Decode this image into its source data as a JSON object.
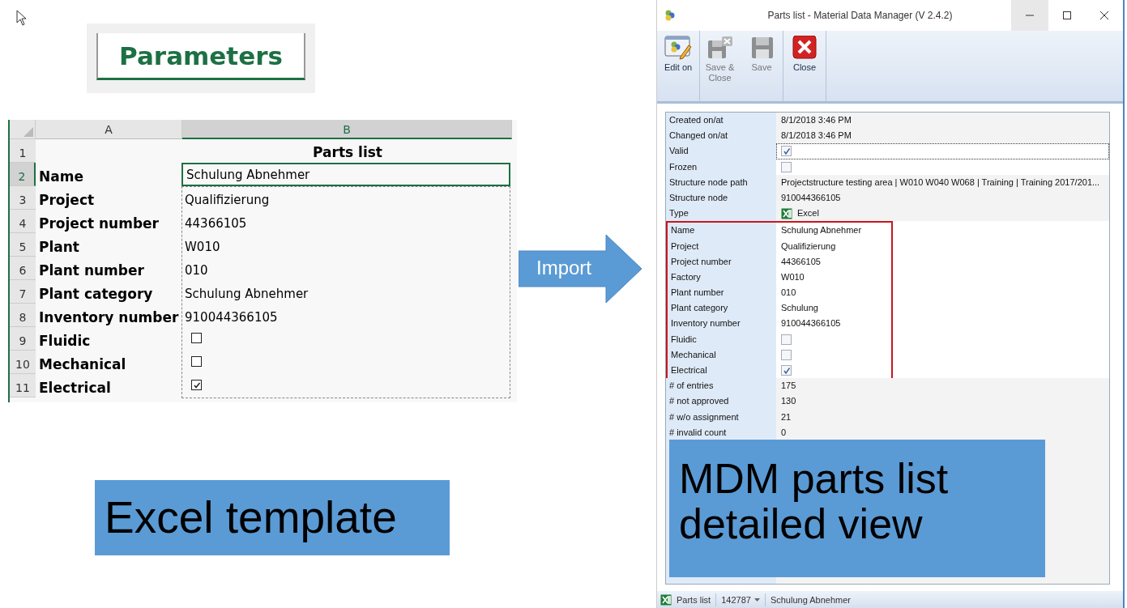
{
  "sheet_tab": {
    "label": "Parameters",
    "selected": true
  },
  "spreadsheet": {
    "columns": [
      {
        "label": "A",
        "selected": false
      },
      {
        "label": "B",
        "selected": true
      }
    ],
    "title_row": {
      "number": "1",
      "title": "Parts list"
    },
    "rows": [
      {
        "number": "2",
        "label": "Name",
        "kind": "text",
        "value": "Schulung Abnehmer",
        "selected": true
      },
      {
        "number": "3",
        "label": "Project",
        "kind": "text",
        "value": "Qualifizierung",
        "selected": false
      },
      {
        "number": "4",
        "label": "Project number",
        "kind": "text",
        "value": "44366105",
        "selected": false
      },
      {
        "number": "5",
        "label": "Plant",
        "kind": "text",
        "value": "W010",
        "selected": false
      },
      {
        "number": "6",
        "label": "Plant number",
        "kind": "text",
        "value": "010",
        "selected": false
      },
      {
        "number": "7",
        "label": "Plant category",
        "kind": "text",
        "value": "Schulung Abnehmer",
        "selected": false
      },
      {
        "number": "8",
        "label": "Inventory number",
        "kind": "text",
        "value": "910044366105",
        "selected": false
      },
      {
        "number": "9",
        "label": "Fluidic",
        "kind": "checkbox",
        "checked": false,
        "selected": false
      },
      {
        "number": "10",
        "label": "Mechanical",
        "kind": "checkbox",
        "checked": false,
        "selected": false
      },
      {
        "number": "11",
        "label": "Electrical",
        "kind": "checkbox",
        "checked": true,
        "selected": false
      }
    ]
  },
  "caption_left": "Excel template",
  "arrow": {
    "label": "Import"
  },
  "window": {
    "title": "Parts list - Material Data Manager (V 2.4.2)",
    "toolbar": [
      {
        "label": "Edit on",
        "kind": "edit",
        "disabled": false,
        "group_end": true
      },
      {
        "label": "Save & Close",
        "kind": "save-close",
        "disabled": true,
        "group_end": false
      },
      {
        "label": "Save",
        "kind": "save",
        "disabled": true,
        "group_end": true
      },
      {
        "label": "Close",
        "kind": "close",
        "disabled": false,
        "group_end": true
      }
    ],
    "properties": [
      {
        "label": "Created on/at",
        "kind": "text",
        "value": "8/1/2018 3:46 PM",
        "selected": false
      },
      {
        "label": "Changed on/at",
        "kind": "text",
        "value": "8/1/2018 3:46 PM",
        "selected": false
      },
      {
        "label": "Valid",
        "kind": "checkbox",
        "checked": true,
        "selected": true
      },
      {
        "label": "Frozen",
        "kind": "checkbox",
        "checked": false,
        "selected": false
      },
      {
        "label": "Structure node path",
        "kind": "text",
        "value": "Projectstructure testing area | W010 W040 W068 | Training | Training 2017/201...",
        "selected": false
      },
      {
        "label": "Structure node",
        "kind": "text",
        "value": "910044366105",
        "selected": false
      },
      {
        "label": "Type",
        "kind": "file-type",
        "value": "Excel",
        "selected": false
      }
    ],
    "imported_properties": [
      {
        "label": "Name",
        "kind": "text",
        "value": "Schulung Abnehmer"
      },
      {
        "label": "Project",
        "kind": "text",
        "value": "Qualifizierung"
      },
      {
        "label": "Project number",
        "kind": "text",
        "value": "44366105"
      },
      {
        "label": "Factory",
        "kind": "text",
        "value": "W010"
      },
      {
        "label": "Plant number",
        "kind": "text",
        "value": "010"
      },
      {
        "label": "Plant category",
        "kind": "text",
        "value": "Schulung"
      },
      {
        "label": "Inventory number",
        "kind": "text",
        "value": "910044366105"
      },
      {
        "label": "Fluidic",
        "kind": "checkbox",
        "checked": false
      },
      {
        "label": "Mechanical",
        "kind": "checkbox",
        "checked": false
      },
      {
        "label": "Electrical",
        "kind": "checkbox",
        "checked": true
      }
    ],
    "statistics": [
      {
        "label": "# of entries",
        "value": "175"
      },
      {
        "label": "# not approved",
        "value": "130"
      },
      {
        "label": "# w/o assignment",
        "value": "21"
      },
      {
        "label": "# invalid count",
        "value": "0"
      }
    ],
    "caption": "MDM parts list detailed view",
    "status_bar": [
      {
        "label": "Parts list",
        "kind": "excel"
      },
      {
        "label": "142787",
        "kind": "dropdown"
      },
      {
        "label": "Schulung Abnehmer",
        "kind": "text"
      }
    ]
  }
}
